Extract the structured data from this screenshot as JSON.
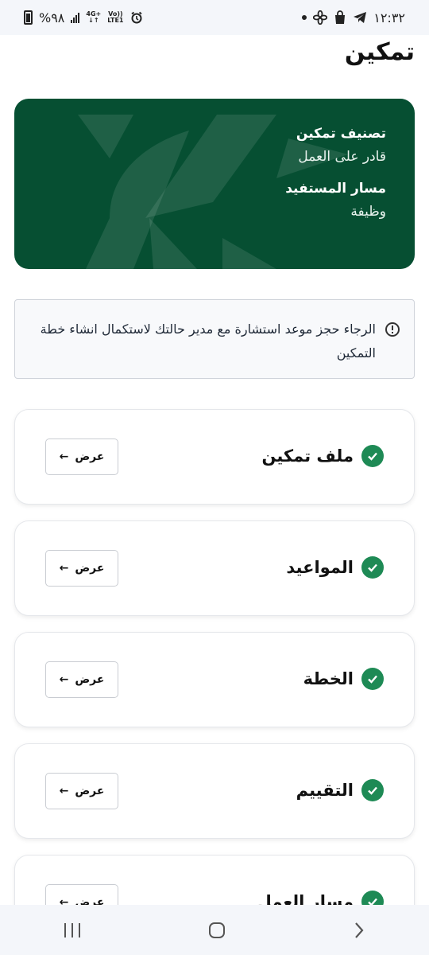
{
  "status_bar": {
    "time": "١٢:٣٢",
    "battery": "%٩٨",
    "network_top": "4G+",
    "network_bottom": "LTE1",
    "volte_top": "Vo))",
    "volte_bottom": "LTE1"
  },
  "header": {
    "title": "تمكين"
  },
  "profile_card": {
    "classification_label": "تصنيف تمكين",
    "classification_value": "قادر على العمل",
    "track_label": "مسار المستفيد",
    "track_value": "وظيفة",
    "background_color": "#064f32"
  },
  "alert": {
    "message": "الرجاء حجز موعد استشارة مع مدير حالتك لاستكمال انشاء خطة التمكين",
    "icon": "alert-circle-icon"
  },
  "sections": [
    {
      "title": "ملف تمكين",
      "button_label": "عرض",
      "status": "complete"
    },
    {
      "title": "المواعيد",
      "button_label": "عرض",
      "status": "complete"
    },
    {
      "title": "الخطة",
      "button_label": "عرض",
      "status": "complete"
    },
    {
      "title": "التقييم",
      "button_label": "عرض",
      "status": "complete"
    },
    {
      "title": "مسار العمل",
      "button_label": "عرض",
      "status": "complete"
    }
  ],
  "colors": {
    "accent_green": "#1e8a55",
    "card_green": "#064f32"
  }
}
